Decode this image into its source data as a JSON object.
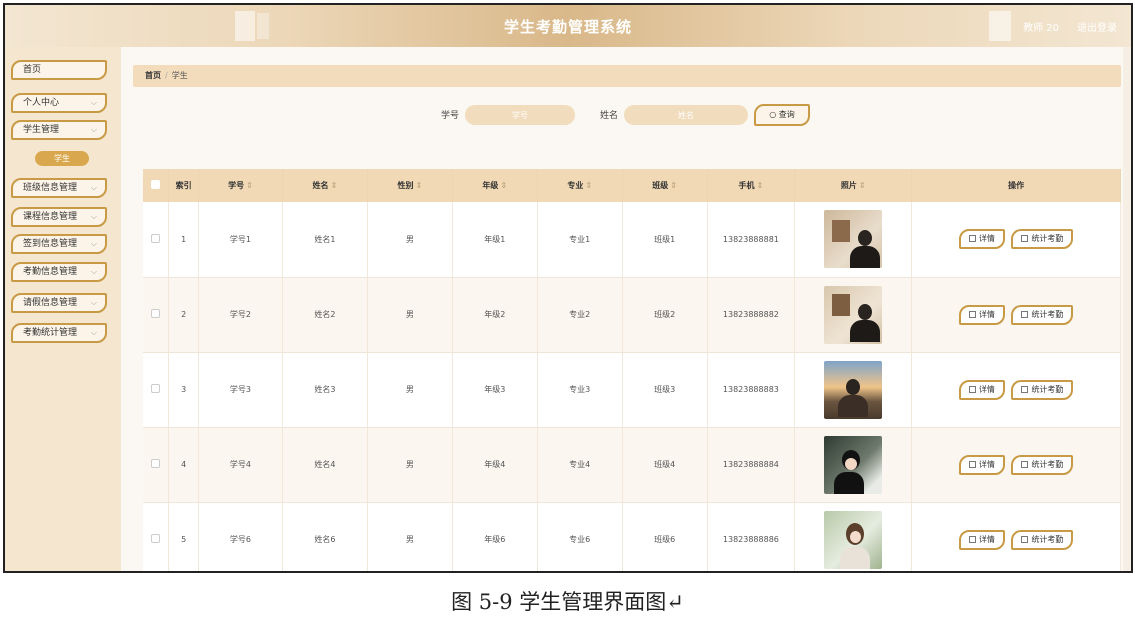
{
  "header": {
    "title": "学生考勤管理系统",
    "user": "教师 20",
    "logout": "退出登录"
  },
  "sidebar": {
    "items": [
      {
        "label": "首页",
        "chevron": false
      },
      {
        "label": "个人中心",
        "chevron": true
      },
      {
        "label": "学生管理",
        "chevron": true
      },
      {
        "label": "班级信息管理",
        "chevron": true
      },
      {
        "label": "课程信息管理",
        "chevron": true
      },
      {
        "label": "签到信息管理",
        "chevron": true
      },
      {
        "label": "考勤信息管理",
        "chevron": true
      },
      {
        "label": "请假信息管理",
        "chevron": true
      },
      {
        "label": "考勤统计管理",
        "chevron": true
      }
    ],
    "sub_item": "学生"
  },
  "breadcrumb": {
    "home": "首页",
    "sep": "/",
    "current": "学生"
  },
  "search": {
    "student_no_label": "学号",
    "student_no_placeholder": "学号",
    "name_label": "姓名",
    "name_placeholder": "姓名",
    "button": "查询"
  },
  "table": {
    "headers": {
      "index": "索引",
      "student_no": "学号",
      "name": "姓名",
      "gender": "性别",
      "grade": "年级",
      "major": "专业",
      "class": "班级",
      "phone": "手机",
      "photo": "照片",
      "actions": "操作"
    },
    "sort_glyph": "⇕",
    "rows": [
      {
        "index": "1",
        "student_no": "学号1",
        "name": "姓名1",
        "gender": "男",
        "grade": "年级1",
        "major": "专业1",
        "class": "班级1",
        "phone": "13823888881"
      },
      {
        "index": "2",
        "student_no": "学号2",
        "name": "姓名2",
        "gender": "男",
        "grade": "年级2",
        "major": "专业2",
        "class": "班级2",
        "phone": "13823888882"
      },
      {
        "index": "3",
        "student_no": "学号3",
        "name": "姓名3",
        "gender": "男",
        "grade": "年级3",
        "major": "专业3",
        "class": "班级3",
        "phone": "13823888883"
      },
      {
        "index": "4",
        "student_no": "学号4",
        "name": "姓名4",
        "gender": "男",
        "grade": "年级4",
        "major": "专业4",
        "class": "班级4",
        "phone": "13823888884"
      },
      {
        "index": "5",
        "student_no": "学号6",
        "name": "姓名6",
        "gender": "男",
        "grade": "年级6",
        "major": "专业6",
        "class": "班级6",
        "phone": "13823888886"
      }
    ],
    "detail_button": "详情",
    "stats_button": "统计考勤"
  },
  "caption": "图 5-9 学生管理界面图↵",
  "colors": {
    "accent": "#c89a45",
    "sidebar_bg": "#f5e6cf",
    "header_row": "#f1d9b6"
  }
}
